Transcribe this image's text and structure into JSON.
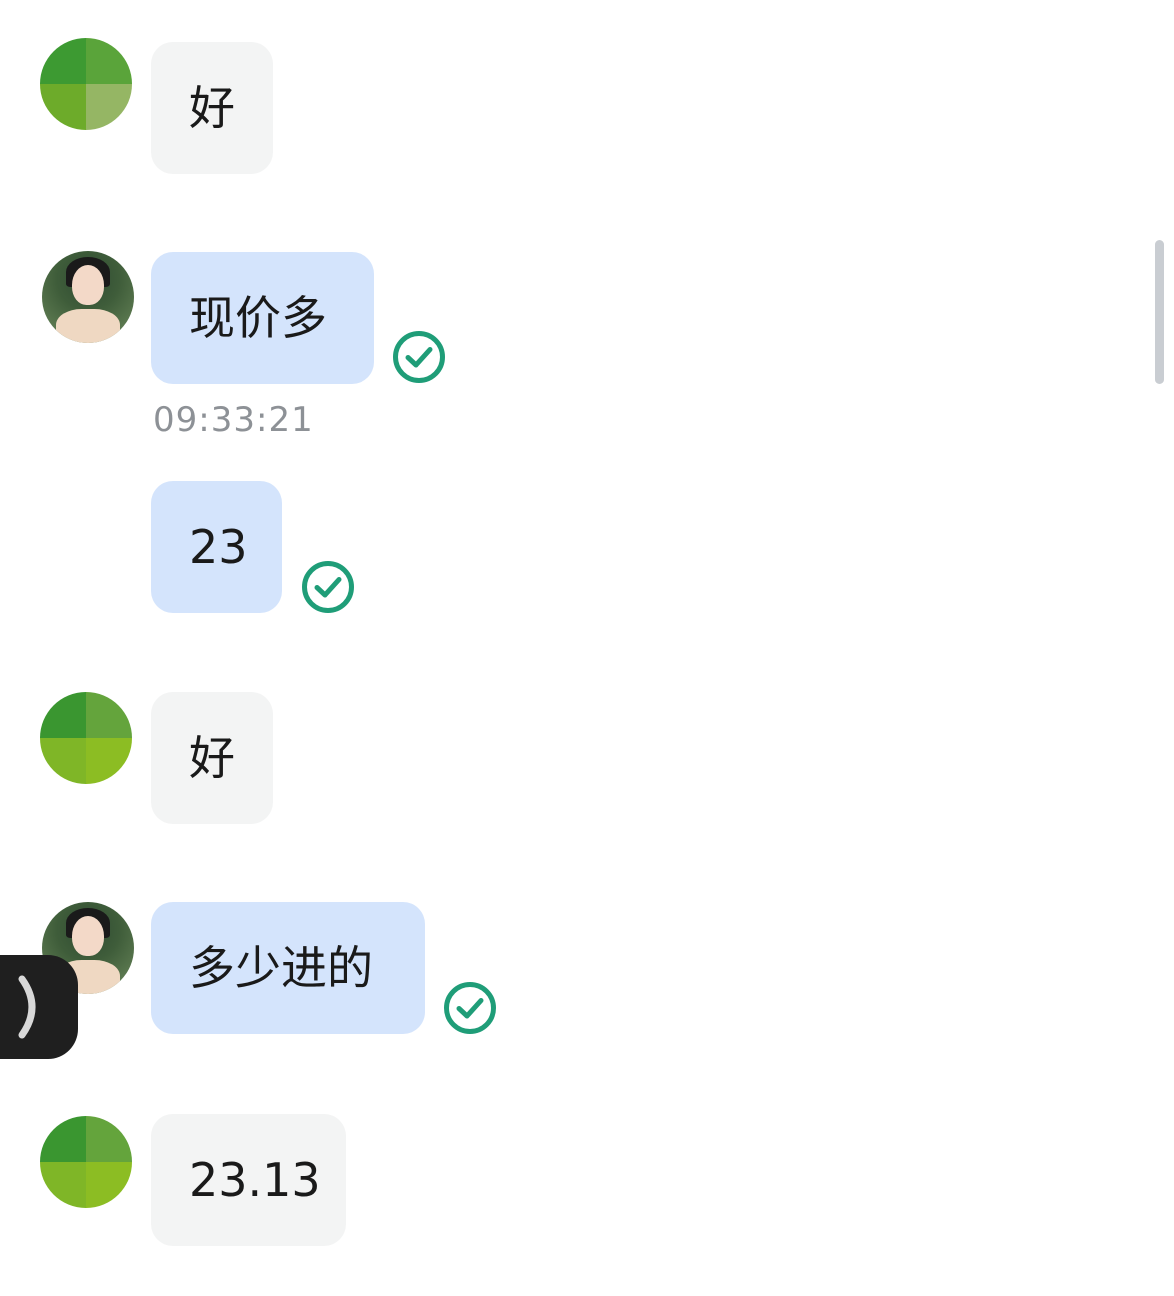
{
  "messages": [
    {
      "sender": "contact",
      "text": "好"
    },
    {
      "sender": "self",
      "text": "现价多",
      "status": "read"
    },
    {
      "sender": "self",
      "timestamp": "09:33:21",
      "text": "23",
      "status": "read"
    },
    {
      "sender": "contact",
      "text": "好"
    },
    {
      "sender": "self",
      "text": "多少进的",
      "status": "read"
    },
    {
      "sender": "contact",
      "text": "23.13"
    }
  ],
  "icons": {
    "read_receipt": "check-circle-icon",
    "side_handle": "chevron-right-icon"
  },
  "colors": {
    "incoming_bubble": "#f3f4f4",
    "outgoing_bubble": "#d4e4fc",
    "read_check": "#1f9d78",
    "timestamp": "#8d9196"
  }
}
